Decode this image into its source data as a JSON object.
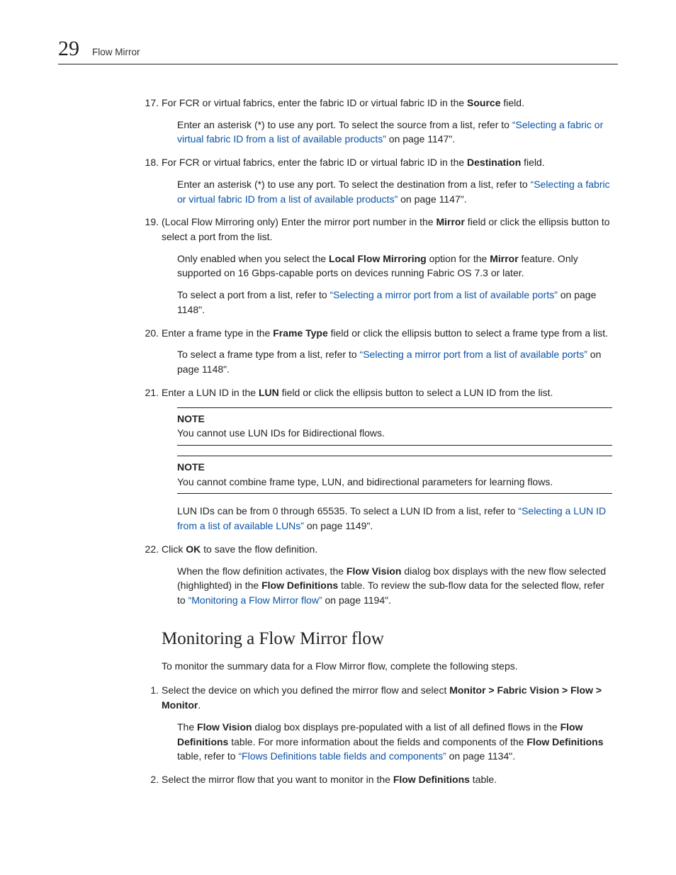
{
  "header": {
    "chapter": "29",
    "title": "Flow Mirror"
  },
  "steps": [
    {
      "num": "17.",
      "body_parts": [
        {
          "t": "For FCR or virtual fabrics, enter the fabric ID or virtual fabric ID in the "
        },
        {
          "t": "Source",
          "bold": true
        },
        {
          "t": " field."
        }
      ],
      "subs": [
        {
          "parts": [
            {
              "t": "Enter an asterisk (*) to use any port. To select the source from a list, refer to "
            },
            {
              "t": "“Selecting a fabric or virtual fabric ID from a list of available products”",
              "link": true
            },
            {
              "t": " on page 1147\"."
            }
          ]
        }
      ]
    },
    {
      "num": "18.",
      "body_parts": [
        {
          "t": "For FCR or virtual fabrics, enter the fabric ID or virtual fabric ID in the "
        },
        {
          "t": "Destination",
          "bold": true
        },
        {
          "t": " field."
        }
      ],
      "subs": [
        {
          "parts": [
            {
              "t": "Enter an asterisk (*) to use any port. To select the destination from a list, refer to "
            },
            {
              "t": "“Selecting a fabric or virtual fabric ID from a list of available products”",
              "link": true
            },
            {
              "t": " on page 1147\"."
            }
          ]
        }
      ]
    },
    {
      "num": "19.",
      "body_parts": [
        {
          "t": "(Local Flow Mirroring only) Enter the mirror port number in the "
        },
        {
          "t": "Mirror",
          "bold": true
        },
        {
          "t": " field or click the ellipsis button to select a port from the list."
        }
      ],
      "subs": [
        {
          "parts": [
            {
              "t": "Only enabled when you select the "
            },
            {
              "t": "Local Flow Mirroring",
              "bold": true
            },
            {
              "t": " option for the "
            },
            {
              "t": "Mirror",
              "bold": true
            },
            {
              "t": " feature. Only supported on 16 Gbps-capable ports on devices running Fabric OS 7.3 or later."
            }
          ]
        },
        {
          "parts": [
            {
              "t": "To select a port from a list, refer to "
            },
            {
              "t": "“Selecting a mirror port from a list of available ports”",
              "link": true
            },
            {
              "t": " on page 1148\"."
            }
          ]
        }
      ]
    },
    {
      "num": "20.",
      "body_parts": [
        {
          "t": "Enter a frame type in the "
        },
        {
          "t": "Frame Type",
          "bold": true
        },
        {
          "t": " field or click the ellipsis button to select a frame type from a list."
        }
      ],
      "subs": [
        {
          "parts": [
            {
              "t": "To select a frame type from a list, refer to "
            },
            {
              "t": "“Selecting a mirror port from a list of available ports”",
              "link": true
            },
            {
              "t": " on page 1148\"."
            }
          ]
        }
      ]
    },
    {
      "num": "21.",
      "body_parts": [
        {
          "t": "Enter a LUN ID in the "
        },
        {
          "t": "LUN",
          "bold": true
        },
        {
          "t": " field or click the ellipsis button to select a LUN ID from the list."
        }
      ],
      "notes": [
        {
          "title": "NOTE",
          "body": "You cannot use LUN IDs for Bidirectional flows."
        },
        {
          "title": "NOTE",
          "body": "You cannot combine frame type, LUN, and bidirectional parameters for learning flows."
        }
      ],
      "subs": [
        {
          "parts": [
            {
              "t": "LUN IDs can be from 0 through 65535. To select a LUN ID from a list, refer to "
            },
            {
              "t": "“Selecting a LUN ID from a list of available LUNs”",
              "link": true
            },
            {
              "t": " on page 1149\"."
            }
          ]
        }
      ]
    },
    {
      "num": "22.",
      "body_parts": [
        {
          "t": "Click "
        },
        {
          "t": "OK",
          "bold": true
        },
        {
          "t": " to save the flow definition."
        }
      ],
      "subs": [
        {
          "parts": [
            {
              "t": "When the flow definition activates, the "
            },
            {
              "t": "Flow Vision",
              "bold": true
            },
            {
              "t": " dialog box displays with the new flow selected (highlighted) in the "
            },
            {
              "t": "Flow Definitions",
              "bold": true
            },
            {
              "t": " table. To review the sub-flow data for the selected flow, refer to "
            },
            {
              "t": "“Monitoring a Flow Mirror flow”",
              "link": true
            },
            {
              "t": " on page 1194\"."
            }
          ]
        }
      ]
    }
  ],
  "section2": {
    "heading": "Monitoring a Flow Mirror flow",
    "lead": "To monitor the summary data for a Flow Mirror flow, complete the following steps.",
    "steps": [
      {
        "num": "1.",
        "body_parts": [
          {
            "t": "Select the device on which you defined the mirror flow and select "
          },
          {
            "t": "Monitor > Fabric Vision > Flow > Monitor",
            "bold": true
          },
          {
            "t": "."
          }
        ],
        "subs": [
          {
            "parts": [
              {
                "t": "The "
              },
              {
                "t": "Flow Vision",
                "bold": true
              },
              {
                "t": " dialog box displays pre-populated with a list of all defined flows in the "
              },
              {
                "t": "Flow Definitions",
                "bold": true
              },
              {
                "t": " table. For more information about the fields and components of the "
              },
              {
                "t": "Flow Definitions",
                "bold": true
              },
              {
                "t": " table, refer to "
              },
              {
                "t": "“Flows Definitions table fields and components”",
                "link": true
              },
              {
                "t": " on page 1134\"."
              }
            ]
          }
        ]
      },
      {
        "num": "2.",
        "body_parts": [
          {
            "t": "Select the mirror flow that you want to monitor in the "
          },
          {
            "t": "Flow Definitions",
            "bold": true
          },
          {
            "t": " table."
          }
        ]
      }
    ]
  }
}
